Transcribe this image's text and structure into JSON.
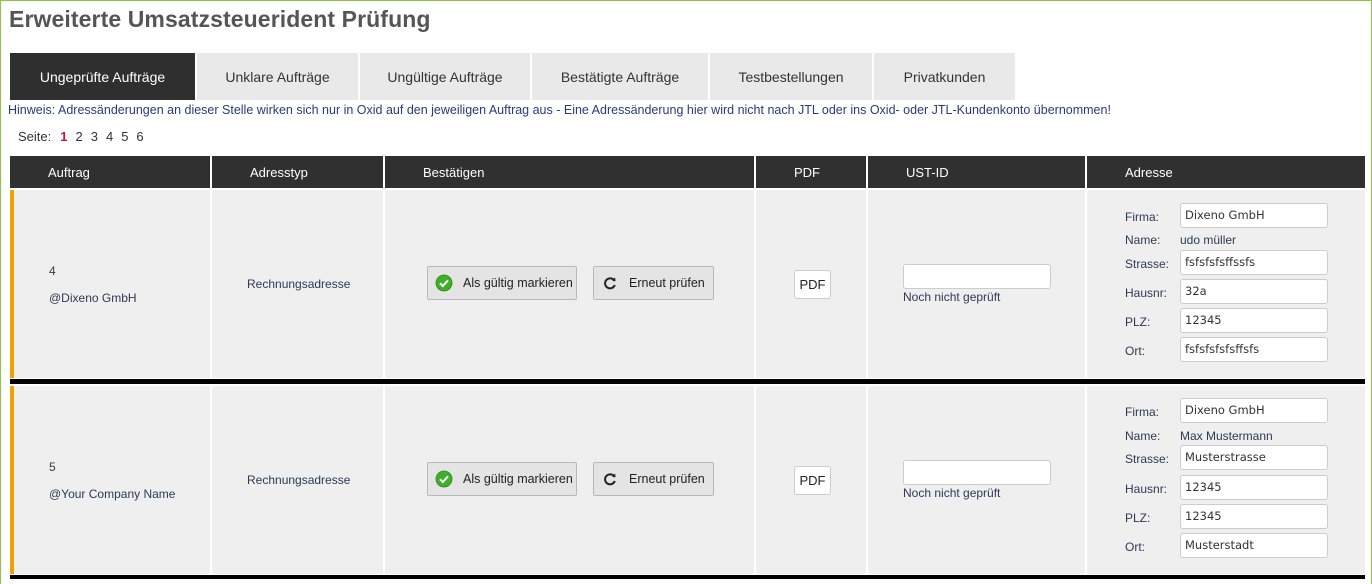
{
  "page_title": "Erweiterte Umsatzsteuerident Prüfung",
  "tabs": [
    {
      "label": "Ungeprüfte Aufträge",
      "active": true
    },
    {
      "label": "Unklare Aufträge"
    },
    {
      "label": "Ungültige Aufträge"
    },
    {
      "label": "Bestätigte Aufträge"
    },
    {
      "label": "Testbestellungen"
    },
    {
      "label": "Privatkunden"
    }
  ],
  "hint": "Hinweis: Adressänderungen an dieser Stelle wirken sich nur in Oxid auf den jeweiligen Auftrag aus - Eine Adressänderung hier wird nicht nach JTL oder ins Oxid- oder JTL-Kundenkonto übernommen!",
  "pager": {
    "label": "Seite:",
    "pages": [
      "1",
      "2",
      "3",
      "4",
      "5",
      "6"
    ],
    "current": "1"
  },
  "columns": [
    "Auftrag",
    "Adresstyp",
    "Bestätigen",
    "PDF",
    "UST-ID",
    "Adresse"
  ],
  "buttons": {
    "valid": "Als gültig markieren",
    "recheck": "Erneut prüfen",
    "pdf": "PDF"
  },
  "address_labels": {
    "firma": "Firma:",
    "name": "Name:",
    "strasse": "Strasse:",
    "hausnr": "Hausnr:",
    "plz": "PLZ:",
    "ort": "Ort:"
  },
  "accent_color": "#f0a000",
  "orders": [
    {
      "id": "4",
      "company": "@Dixeno GmbH",
      "address_type": "Rechnungsadresse",
      "ust_id": "",
      "ust_status": "Noch nicht geprüft",
      "address": {
        "firma": "Dixeno GmbH",
        "name": "udo müller",
        "strasse": "fsfsfsfsffssfs",
        "hausnr": "32a",
        "plz": "12345",
        "ort": "fsfsfsfsfsffsfs"
      }
    },
    {
      "id": "5",
      "company": "@Your Company Name",
      "address_type": "Rechnungsadresse",
      "ust_id": "",
      "ust_status": "Noch nicht geprüft",
      "address": {
        "firma": "Dixeno GmbH",
        "name": "Max Mustermann",
        "strasse": "Musterstrasse",
        "hausnr": "12345",
        "plz": "12345",
        "ort": "Musterstadt"
      }
    }
  ]
}
